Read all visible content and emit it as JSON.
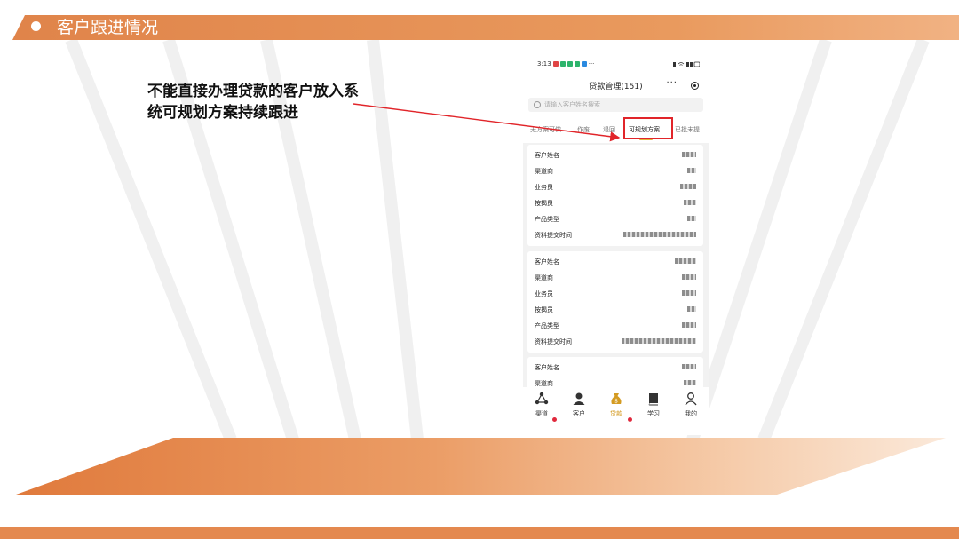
{
  "slide": {
    "title": "客户跟进情况",
    "annotation": "不能直接办理贷款的客户放入系统可规划方案持续跟进",
    "colors": {
      "accent": "#e0844a",
      "highlight": "#e1252a",
      "nav_active": "#d49b22"
    }
  },
  "phone": {
    "status_time": "3:13",
    "status_dots": "···",
    "header_title": "贷款管理(151)",
    "more_label": "···",
    "search_placeholder": "请输入客户姓名搜索",
    "tabs": [
      {
        "label": "无方案可做"
      },
      {
        "label": "作废"
      },
      {
        "label": "退回"
      },
      {
        "label": "可规划方案",
        "active": true
      },
      {
        "label": "已批未提"
      }
    ],
    "cards": [
      {
        "rows": [
          "客户姓名",
          "渠道商",
          "业务员",
          "按揭员",
          "产品类型",
          "资料提交时间"
        ]
      },
      {
        "rows": [
          "客户姓名",
          "渠道商",
          "业务员",
          "按揭员",
          "产品类型",
          "资料提交时间"
        ]
      },
      {
        "rows": [
          "客户姓名",
          "渠道商"
        ]
      }
    ],
    "nav": [
      {
        "label": "渠道",
        "icon": "share-icon"
      },
      {
        "label": "客户",
        "icon": "person-icon"
      },
      {
        "label": "贷款",
        "icon": "moneybag-icon",
        "active": true
      },
      {
        "label": "学习",
        "icon": "book-icon"
      },
      {
        "label": "我的",
        "icon": "user-outline-icon"
      }
    ]
  }
}
